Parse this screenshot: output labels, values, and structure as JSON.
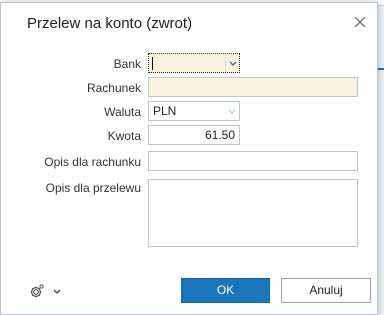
{
  "dialog": {
    "title": "Przelew na konto (zwrot)"
  },
  "form": {
    "bank_label": "Bank",
    "bank_value": "",
    "rachunek_label": "Rachunek",
    "rachunek_value": "",
    "waluta_label": "Waluta",
    "waluta_value": "PLN",
    "kwota_label": "Kwota",
    "kwota_value": "61.50",
    "opis_rachunku_label": "Opis dla rachunku",
    "opis_rachunku_value": "",
    "opis_przelewu_label": "Opis dla przelewu",
    "opis_przelewu_value": ""
  },
  "footer": {
    "settings_icon": "gear-icon",
    "ok_label": "OK",
    "cancel_label": "Anuluj"
  },
  "colors": {
    "accent": "#1a76b8",
    "required_field": "#fdf3e1"
  }
}
